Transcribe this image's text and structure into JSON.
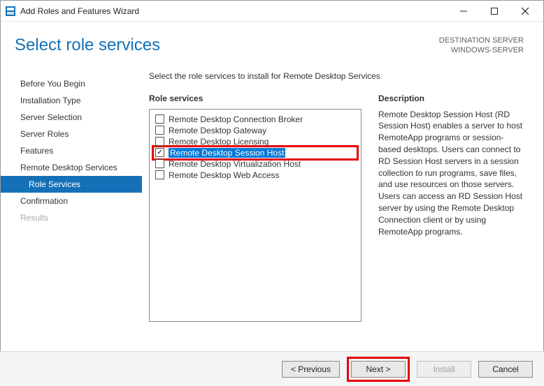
{
  "window": {
    "title": "Add Roles and Features Wizard"
  },
  "header": {
    "heading": "Select role services",
    "dest_label": "DESTINATION SERVER",
    "dest_value": "WINDOWS-SERVER"
  },
  "sidebar": {
    "items": [
      {
        "label": "Before You Begin",
        "selected": false,
        "disabled": false,
        "child": false
      },
      {
        "label": "Installation Type",
        "selected": false,
        "disabled": false,
        "child": false
      },
      {
        "label": "Server Selection",
        "selected": false,
        "disabled": false,
        "child": false
      },
      {
        "label": "Server Roles",
        "selected": false,
        "disabled": false,
        "child": false
      },
      {
        "label": "Features",
        "selected": false,
        "disabled": false,
        "child": false
      },
      {
        "label": "Remote Desktop Services",
        "selected": false,
        "disabled": false,
        "child": false
      },
      {
        "label": "Role Services",
        "selected": true,
        "disabled": false,
        "child": true
      },
      {
        "label": "Confirmation",
        "selected": false,
        "disabled": false,
        "child": false
      },
      {
        "label": "Results",
        "selected": false,
        "disabled": true,
        "child": false
      }
    ]
  },
  "main": {
    "instruction": "Select the role services to install for Remote Desktop Services",
    "list_label": "Role services",
    "services": [
      {
        "label": "Remote Desktop Connection Broker",
        "checked": false,
        "selected": false,
        "highlighted": false
      },
      {
        "label": "Remote Desktop Gateway",
        "checked": false,
        "selected": false,
        "highlighted": false
      },
      {
        "label": "Remote Desktop Licensing",
        "checked": false,
        "selected": false,
        "highlighted": false
      },
      {
        "label": "Remote Desktop Session Host",
        "checked": true,
        "selected": true,
        "highlighted": true
      },
      {
        "label": "Remote Desktop Virtualization Host",
        "checked": false,
        "selected": false,
        "highlighted": false
      },
      {
        "label": "Remote Desktop Web Access",
        "checked": false,
        "selected": false,
        "highlighted": false
      }
    ],
    "desc_label": "Description",
    "desc_text": "Remote Desktop Session Host (RD Session Host) enables a server to host RemoteApp programs or session-based desktops. Users can connect to RD Session Host servers in a session collection to run programs, save files, and use resources on those servers. Users can access an RD Session Host server by using the Remote Desktop Connection client or by using RemoteApp programs."
  },
  "footer": {
    "previous": "< Previous",
    "next": "Next >",
    "install": "Install",
    "cancel": "Cancel"
  }
}
